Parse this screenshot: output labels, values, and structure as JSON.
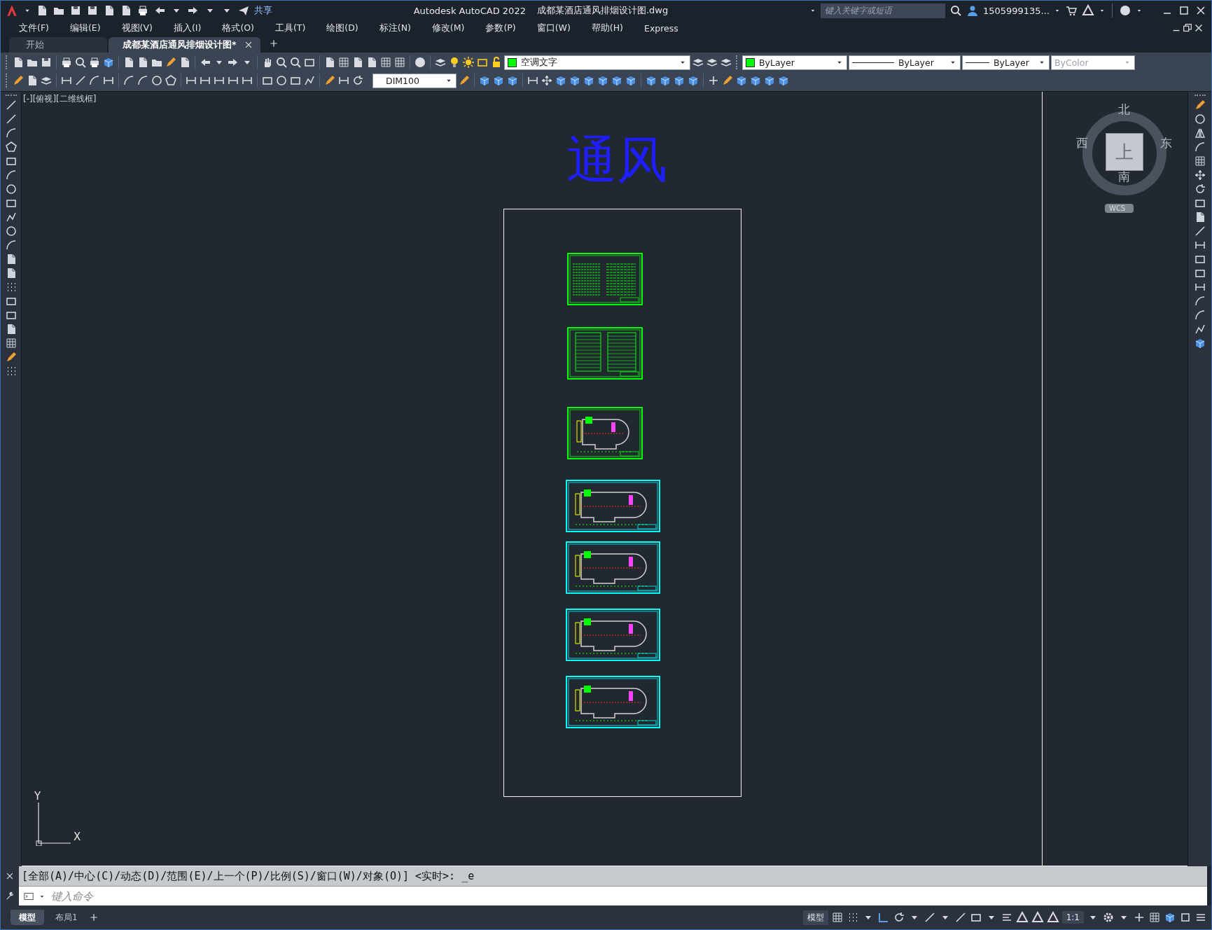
{
  "title_bar": {
    "share": "共享",
    "app_title": "Autodesk AutoCAD 2022",
    "file_name": "成都某酒店通风排烟设计图.dwg",
    "search_placeholder": "键入关键字或短语",
    "user": "1505999135..."
  },
  "menu": [
    "文件(F)",
    "编辑(E)",
    "视图(V)",
    "插入(I)",
    "格式(O)",
    "工具(T)",
    "绘图(D)",
    "标注(N)",
    "修改(M)",
    "参数(P)",
    "窗口(W)",
    "帮助(H)",
    "Express"
  ],
  "doc_tabs": [
    {
      "label": "开始",
      "selected": false
    },
    {
      "label": "成都某酒店通风排烟设计图*",
      "selected": true
    }
  ],
  "toolbar": {
    "layer": {
      "name": "空调文字",
      "color": "#00ff00"
    },
    "color": {
      "label": "ByLayer",
      "color": "#00ff00"
    },
    "linetype": "ByLayer",
    "lineweight": "ByLayer",
    "plot_style": {
      "label": "ByColor",
      "disabled": true
    },
    "dim_style": "DIM100"
  },
  "canvas": {
    "viewport_label": "[-][俯视][二维线框]",
    "title": "通风",
    "sheets": [
      {
        "kind": "notes",
        "color": "#00ff00"
      },
      {
        "kind": "table",
        "color": "#00ff00"
      },
      {
        "kind": "plan",
        "color": "#00ff00"
      },
      {
        "kind": "plan",
        "color": "#00ffff"
      },
      {
        "kind": "plan",
        "color": "#00ffff"
      },
      {
        "kind": "plan",
        "color": "#00ffff"
      },
      {
        "kind": "plan",
        "color": "#00ffff"
      }
    ],
    "viewcube": {
      "north": "北",
      "south": "南",
      "east": "东",
      "west": "西",
      "face": "上",
      "wcs": "WCS"
    },
    "ucs": {
      "x": "X",
      "y": "Y"
    }
  },
  "command": {
    "history": "[全部(A)/中心(C)/动态(D)/范围(E)/上一个(P)/比例(S)/窗口(W)/对象(O)] <实时>: _e",
    "placeholder": "键入命令"
  },
  "layout_tabs": [
    {
      "label": "模型",
      "selected": true
    },
    {
      "label": "布局1",
      "selected": false
    }
  ],
  "status_bar": {
    "space": "模型",
    "scale": "1:1"
  }
}
